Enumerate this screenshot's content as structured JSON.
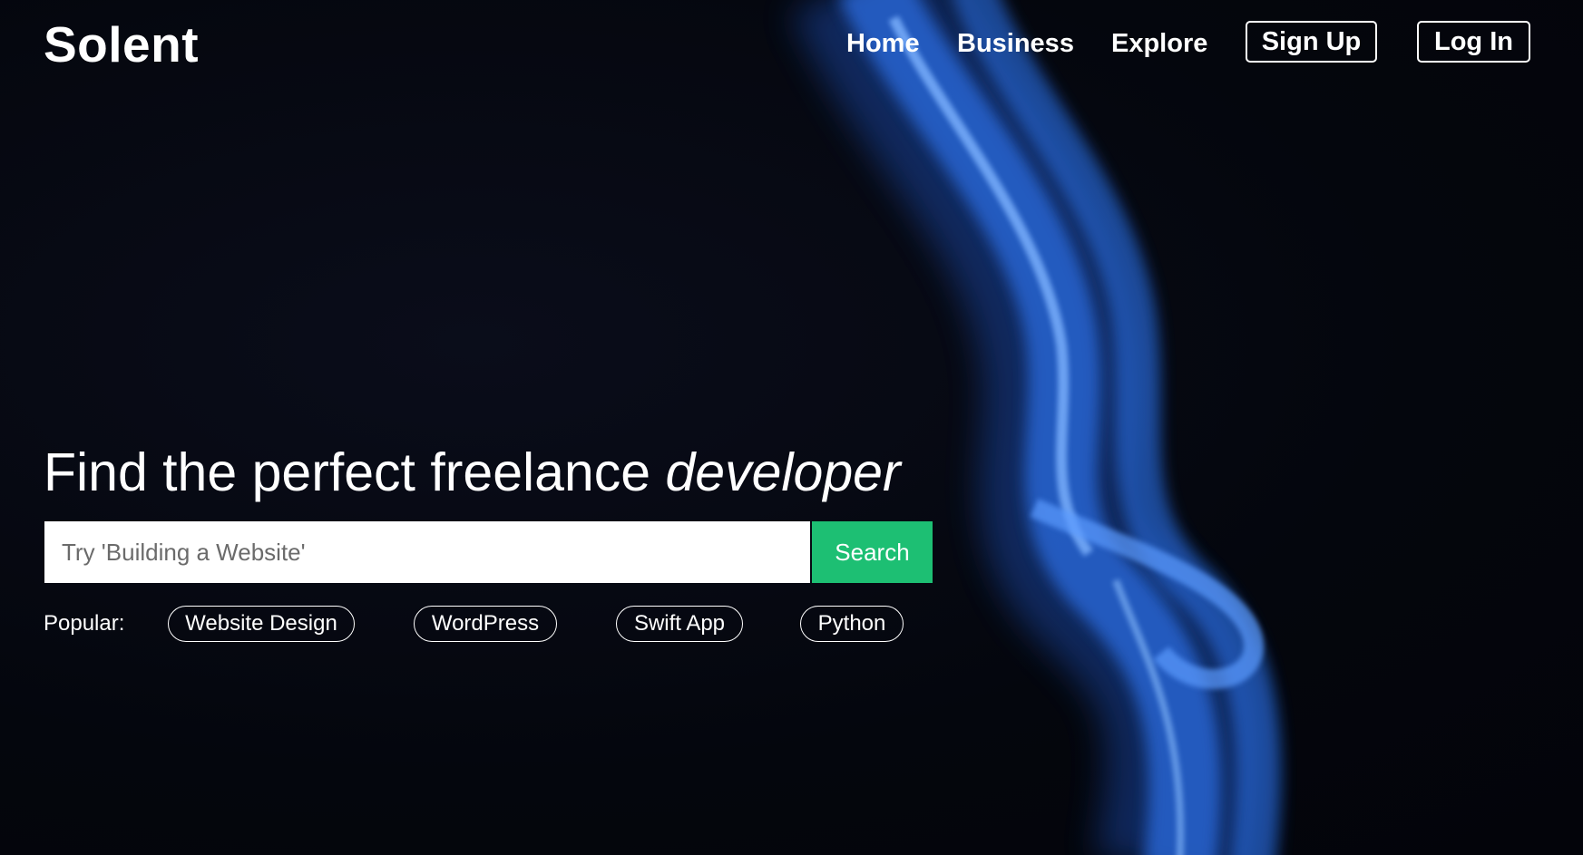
{
  "brand": {
    "logo_text": "Solent"
  },
  "nav": {
    "home": "Home",
    "business": "Business",
    "explore": "Explore",
    "signup": "Sign Up",
    "login": "Log In"
  },
  "hero": {
    "headline_main": "Find the perfect freelance ",
    "headline_emphasis": "developer",
    "search_placeholder": "Try 'Building a Website'",
    "search_button": "Search",
    "popular_label": "Popular:",
    "popular_tags": [
      "Website Design",
      "WordPress",
      "Swift App",
      "Python"
    ]
  },
  "colors": {
    "background": "#05070f",
    "accent_green": "#1dbf73",
    "smoke_blue": "#2f7bff"
  }
}
